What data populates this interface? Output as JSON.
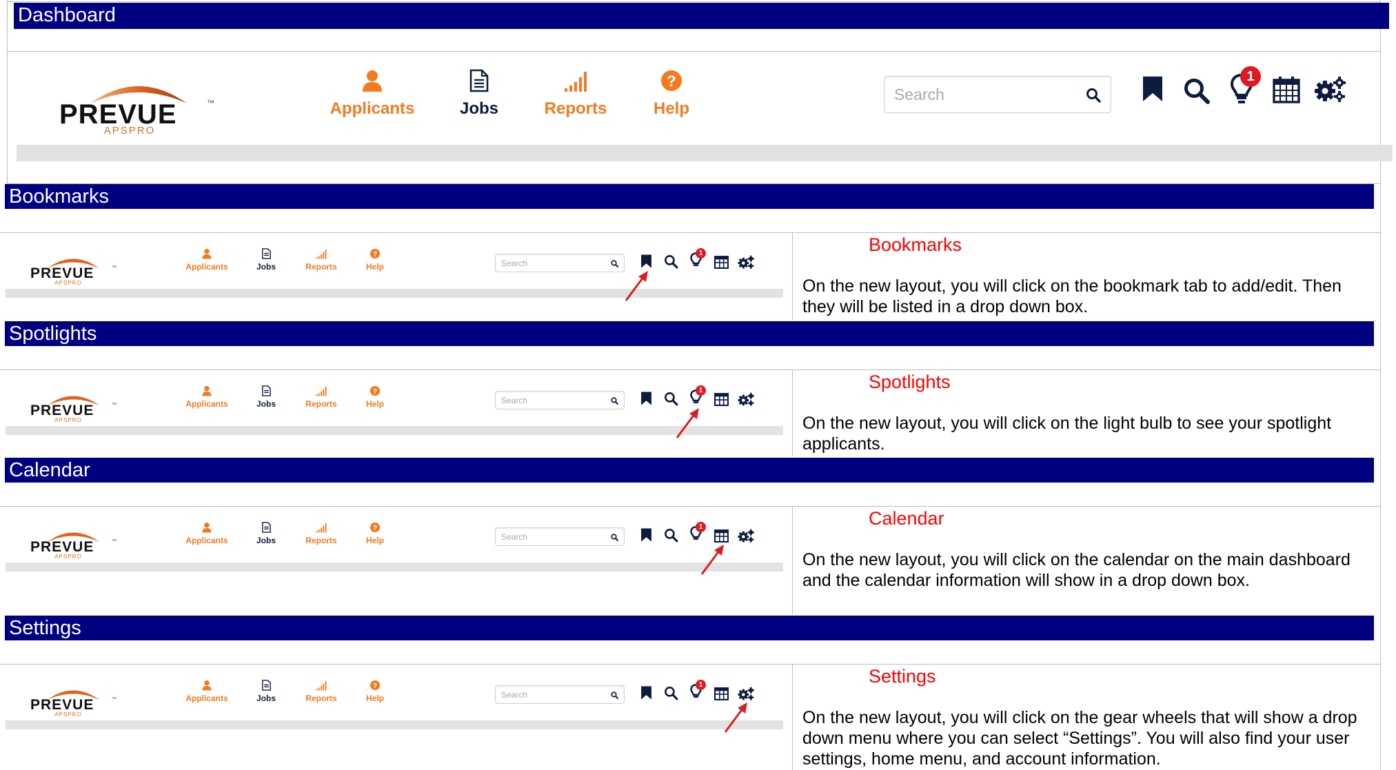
{
  "sections": {
    "dashboard": "Dashboard",
    "bookmarks": "Bookmarks",
    "spotlights": "Spotlights",
    "calendar": "Calendar",
    "settings": "Settings"
  },
  "header": {
    "logo": {
      "name": "PREVUE",
      "tm": "™",
      "sub": "APSPRO"
    },
    "nav": [
      {
        "label": "Applicants",
        "icon": "person-icon"
      },
      {
        "label": "Jobs",
        "icon": "document-icon"
      },
      {
        "label": "Reports",
        "icon": "bar-chart-icon"
      },
      {
        "label": "Help",
        "icon": "question-icon"
      }
    ],
    "search_placeholder": "Search",
    "notification_count": "1",
    "toolbar_icons": [
      "bookmark-icon",
      "search-icon",
      "lightbulb-icon",
      "calendar-icon",
      "gears-icon"
    ]
  },
  "descriptions": {
    "bookmarks": {
      "title": "Bookmarks",
      "text": "On the new layout, you will click on the bookmark tab to add/edit. Then they will be listed in a drop down box."
    },
    "spotlights": {
      "title": "Spotlights",
      "text": "On the new layout, you will click on the light bulb to see your spotlight applicants."
    },
    "calendar": {
      "title": "Calendar",
      "text": "On the new layout, you will click on the calendar on the main dashboard and the calendar information will show in a drop down box."
    },
    "settings": {
      "title": "Settings",
      "text": "On the new layout, you will click on the gear wheels that will show a drop down menu where you can select “Settings”. You will also find your user settings, home menu, and account information."
    }
  },
  "colors": {
    "banner": "#000080",
    "orange": "#f47a20",
    "navy_icon": "#0d1b3e",
    "red": "#ff0000",
    "badge": "#e0181f",
    "arrow": "#d42020"
  }
}
